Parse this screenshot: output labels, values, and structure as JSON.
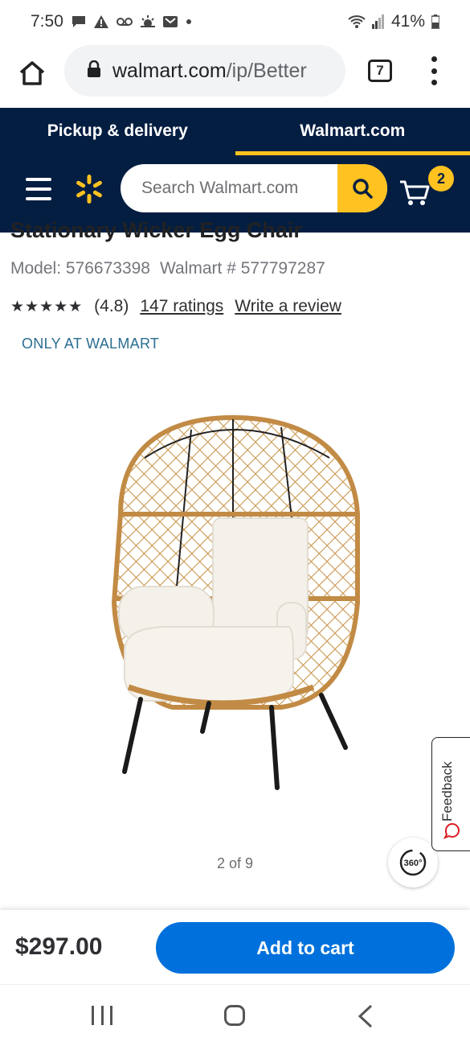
{
  "status_bar": {
    "time": "7:50",
    "battery": "41%"
  },
  "browser": {
    "url_domain": "walmart.com",
    "url_path": "/ip/Better",
    "tab_count": "7"
  },
  "header": {
    "tabs": [
      {
        "label": "Pickup & delivery"
      },
      {
        "label": "Walmart.com",
        "active": true
      }
    ],
    "search_placeholder": "Search Walmart.com",
    "cart_count": "2",
    "brand_color": "#041e42",
    "accent_color": "#ffc220"
  },
  "product": {
    "title_partial": "Stationary Wicker Egg Chair",
    "model_label": "Model: 576673398",
    "walmart_number": "Walmart # 577797287",
    "stars": "★★★★★",
    "rating_value": "(4.8)",
    "ratings_link": "147 ratings",
    "write_review": "Write a review",
    "badge": "ONLY AT WALMART",
    "image_counter": "2 of 9",
    "view_360_label": "360°"
  },
  "feedback": {
    "label": "Feedback"
  },
  "sticky": {
    "price": "$297.00",
    "add_to_cart": "Add to cart",
    "button_color": "#0071dc"
  }
}
